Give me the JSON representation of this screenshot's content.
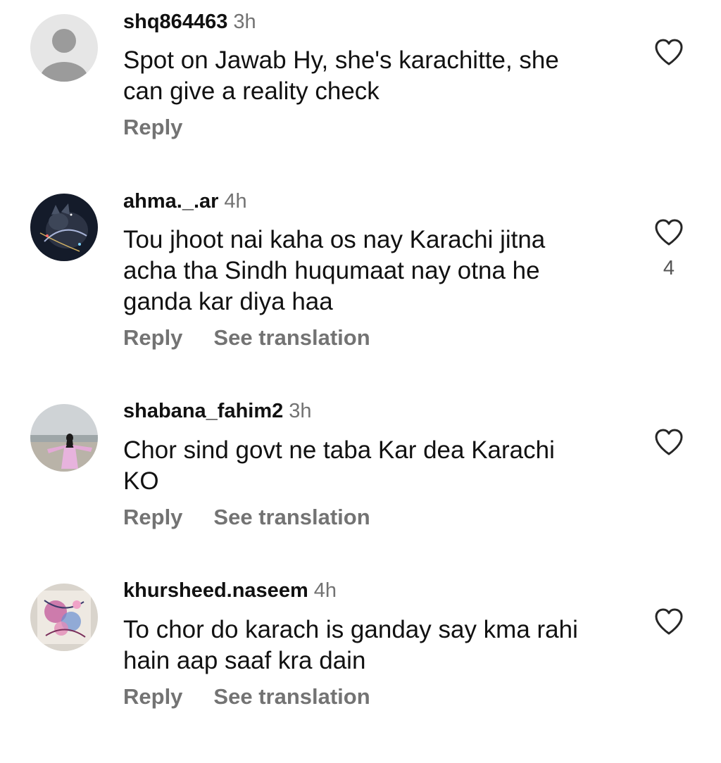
{
  "comments": [
    {
      "username": "shq864463",
      "time": "3h",
      "lines": [
        "Spot on Jawab Hy, she's karachitte, she",
        "can give a reality check"
      ],
      "reply_label": "Reply",
      "translation_label": "",
      "like_count": "",
      "avatar": "default-avatar"
    },
    {
      "username": "ahma._.ar",
      "time": "4h",
      "lines": [
        "Tou jhoot nai kaha os nay Karachi jitna",
        "acha tha Sindh huqumaat nay otna he",
        "ganda kar diya haa"
      ],
      "reply_label": "Reply",
      "translation_label": "See translation",
      "like_count": "4",
      "avatar": "cat-photo-avatar"
    },
    {
      "username": "shabana_fahim2",
      "time": "3h",
      "lines": [
        "Chor sind govt ne taba Kar dea Karachi",
        "KO"
      ],
      "reply_label": "Reply",
      "translation_label": "See translation",
      "like_count": "",
      "avatar": "beach-photo-avatar"
    },
    {
      "username": "khursheed.naseem",
      "time": "4h",
      "lines": [
        "To chor do karach is ganday say kma rahi",
        "hain aap saaf kra dain"
      ],
      "reply_label": "Reply",
      "translation_label": "See translation",
      "like_count": "",
      "avatar": "art-photo-avatar"
    }
  ],
  "colors": {
    "text": "#111111",
    "secondary": "#737373",
    "default_avatar_bg": "#e6e6e6",
    "default_avatar_fg": "#9b9b9b"
  },
  "icons": {
    "like": "heart-outline-icon"
  }
}
